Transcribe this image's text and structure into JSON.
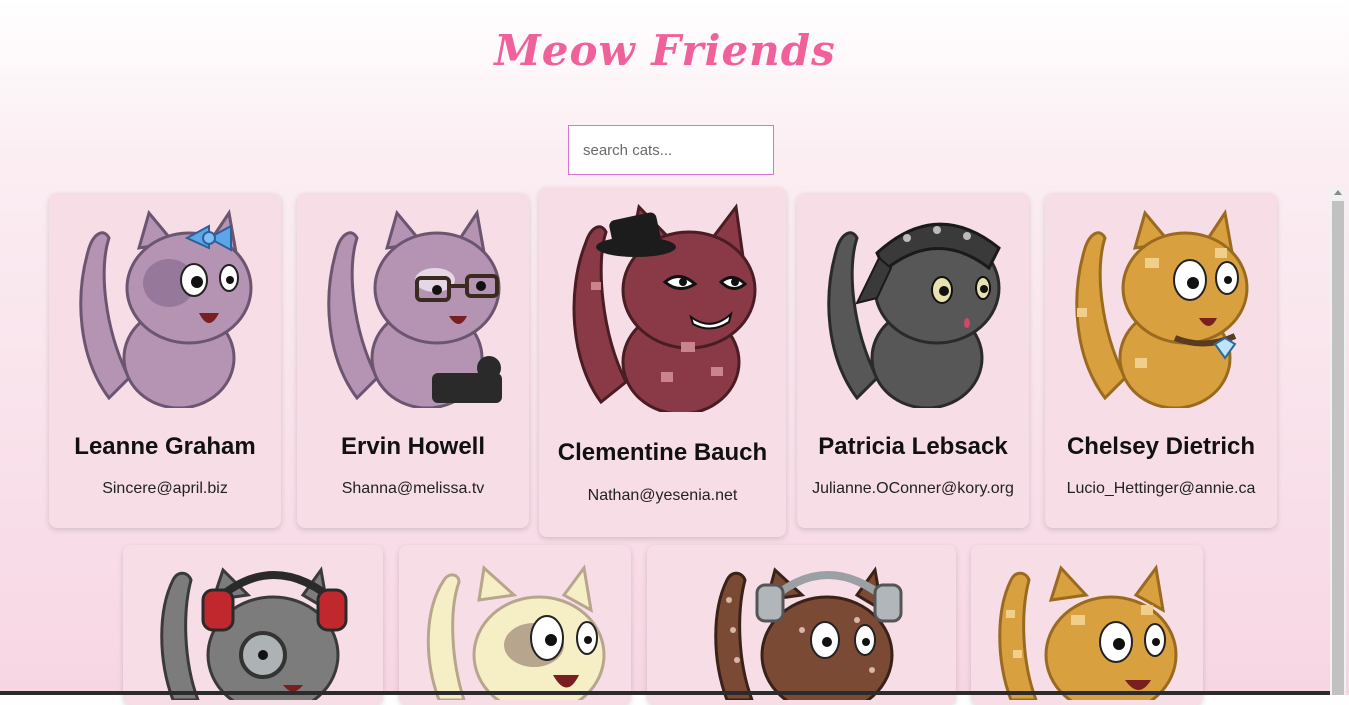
{
  "app": {
    "title": "Meow Friends"
  },
  "search": {
    "placeholder": "search cats..."
  },
  "cats": [
    {
      "name": "Leanne Graham",
      "email": "Sincere@april.biz",
      "fur": "#b593b3",
      "patch": "#96789a",
      "accessory": "bow"
    },
    {
      "name": "Ervin Howell",
      "email": "Shanna@melissa.tv",
      "fur": "#b593b3",
      "patch": "#e6d7e6",
      "accessory": "glasses"
    },
    {
      "name": "Clementine Bauch",
      "email": "Nathan@yesenia.net",
      "fur": "#8a3a47",
      "patch": "#c9848d",
      "accessory": "top-hat"
    },
    {
      "name": "Patricia Lebsack",
      "email": "Julianne.OConner@kory.org",
      "fur": "#575757",
      "patch": "#3a3a3a",
      "accessory": "bandana"
    },
    {
      "name": "Chelsey Dietrich",
      "email": "Lucio_Hettinger@annie.ca",
      "fur": "#d9a03f",
      "patch": "#f0cf8a",
      "accessory": "diamond-collar"
    },
    {
      "name": "",
      "email": "",
      "fur": "#7c7c7c",
      "patch": "#5e5e5e",
      "accessory": "headphones"
    },
    {
      "name": "",
      "email": "",
      "fur": "#f6efc6",
      "patch": "#b8a58e",
      "accessory": "none"
    },
    {
      "name": "",
      "email": "",
      "fur": "#7a4a34",
      "patch": "#d8b7a7",
      "accessory": "headphones"
    },
    {
      "name": "",
      "email": "",
      "fur": "#d9a03f",
      "patch": "#f0cf8a",
      "accessory": "none"
    }
  ]
}
